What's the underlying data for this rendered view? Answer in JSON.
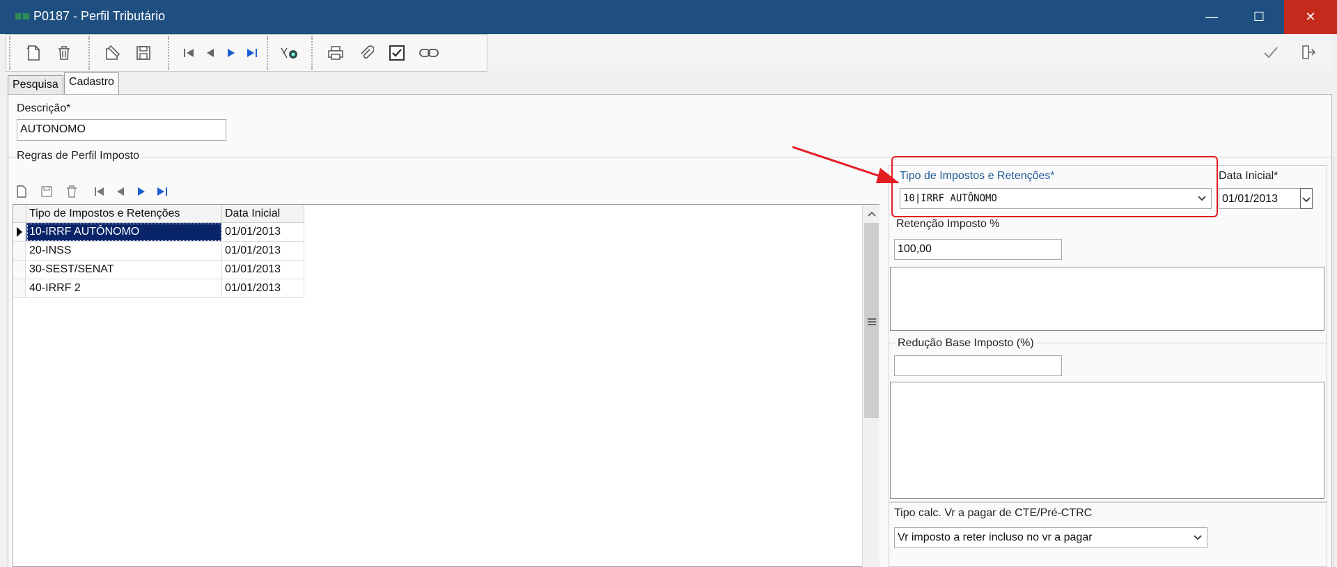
{
  "window": {
    "title": "P0187 - Perfil Tributário",
    "controls": {
      "minimize": "—",
      "maximize": "☐",
      "close": "✕"
    }
  },
  "toolbar": {
    "icons": [
      "new-document-icon",
      "delete-icon",
      "edit-icon",
      "save-icon",
      "first-record-icon",
      "previous-record-icon",
      "next-record-icon",
      "last-record-icon",
      "search-record-icon",
      "print-icon",
      "attach-icon",
      "checkbox-icon",
      "link-icon",
      "confirm-icon",
      "exit-icon"
    ]
  },
  "tabs": [
    {
      "label": "Pesquisa"
    },
    {
      "label": "Cadastro"
    }
  ],
  "form": {
    "descricao_label": "Descrição*",
    "descricao_value": "AUTONOMO",
    "regras_group_label": "Regras de Perfil Imposto"
  },
  "grid": {
    "columns": [
      "Tipo de Impostos e Retenções",
      "Data Inicial"
    ],
    "rows": [
      {
        "tipo": "10-IRRF AUTÔNOMO",
        "data": "01/01/2013"
      },
      {
        "tipo": "20-INSS",
        "data": "01/01/2013"
      },
      {
        "tipo": "30-SEST/SENAT",
        "data": "01/01/2013"
      },
      {
        "tipo": "40-IRRF 2",
        "data": "01/01/2013"
      }
    ]
  },
  "detail": {
    "tipo_label": "Tipo de Impostos e Retenções*",
    "tipo_value": "10|IRRF AUTÔNOMO",
    "data_inicial_label": "Data Inicial*",
    "data_inicial_value": "01/01/2013",
    "retencao_label": "Retenção Imposto %",
    "retencao_value": "100,00",
    "reducao_label": "Redução Base Imposto (%)",
    "reducao_value": "",
    "tipo_calc_label": "Tipo calc. Vr a pagar de CTE/Pré-CTRC",
    "tipo_calc_value": "Vr imposto a reter incluso no vr a pagar"
  },
  "colors": {
    "titlebar": "#1e4f80",
    "close": "#c42b1c",
    "annotation": "#e31b23",
    "selection": "#0a246a",
    "nav_blue": "#1a5fd1"
  }
}
